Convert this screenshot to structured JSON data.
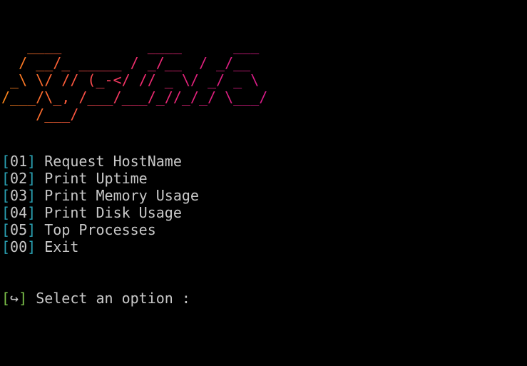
{
  "banner": {
    "art": "   ____          ____      ___\n  / __/_ _____ / _/__  / _/__\n _\\ \\/ // (_-</ // _ \\/ _/ _ \\\n/___/\\_, /___/___/_//_/_/ \\___/\n    /___/"
  },
  "menu": {
    "items": [
      {
        "bracket_open": "[",
        "key": "01",
        "bracket_close": "]",
        "label": "Request HostName"
      },
      {
        "bracket_open": "[",
        "key": "02",
        "bracket_close": "]",
        "label": "Print Uptime"
      },
      {
        "bracket_open": "[",
        "key": "03",
        "bracket_close": "]",
        "label": "Print Memory Usage"
      },
      {
        "bracket_open": "[",
        "key": "04",
        "bracket_close": "]",
        "label": "Print Disk Usage"
      },
      {
        "bracket_open": "[",
        "key": "05",
        "bracket_close": "]",
        "label": "Top Processes"
      },
      {
        "bracket_open": "[",
        "key": "00",
        "bracket_close": "]",
        "label": "Exit"
      }
    ]
  },
  "prompt": {
    "bracket_open": "[",
    "icon": "↪",
    "bracket_close": "]",
    "text": "Select an option :"
  },
  "colors": {
    "background": "#000000",
    "text": "#c8c8c8",
    "bracket": "#2aa1b3",
    "prompt_bracket": "#7cc24a",
    "banner_start": "#ff8a1a",
    "banner_end": "#d81b8a"
  }
}
